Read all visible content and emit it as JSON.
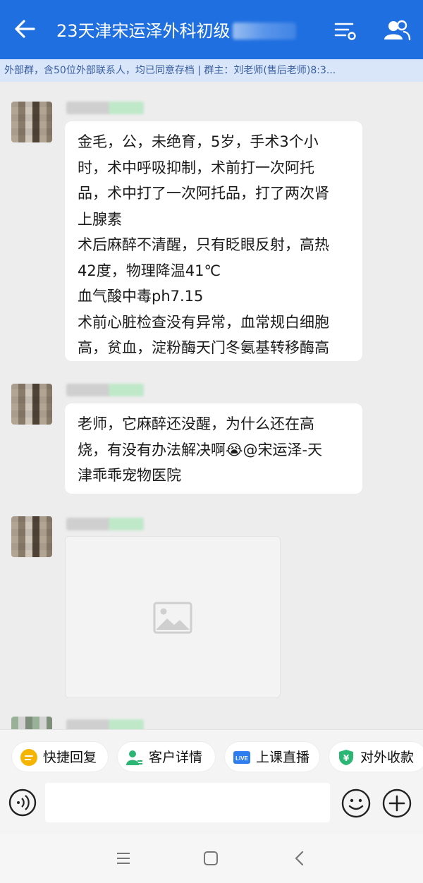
{
  "header": {
    "title": "23天津宋运泽外科初级",
    "subtitle": "外部群，含50位外部联系人，均已同意存档 | 群主：刘老师(售后老师)8:3..."
  },
  "messages": [
    {
      "type": "text",
      "lines": [
        "金毛，公，未绝育，5岁，手术3个小",
        "时，术中呼吸抑制，术前打一次阿托",
        "品，术中打了一次阿托品，打了两次肾",
        "上腺素",
        "术后麻醉不清醒，只有眨眼反射，高热",
        "42度，物理降温41℃",
        "血气酸中毒ph7.15",
        "术前心脏检查没有异常，血常规白细胞",
        "高，贫血，淀粉酶天门冬氨基转移酶高"
      ]
    },
    {
      "type": "text",
      "lines": [
        "老师，它麻醉还没醒，为什么还在高",
        "烧，有没有办法解决啊😭@宋运泽-天",
        "津乖乖宠物医院"
      ]
    },
    {
      "type": "image"
    }
  ],
  "quickbar": {
    "quick_reply": "快捷回复",
    "customer_details": "客户详情",
    "live_class": "上课直播",
    "live_badge": "LIVE",
    "payment": "对外收款",
    "payment_symbol": "¥"
  },
  "input": {
    "value": ""
  },
  "colors": {
    "header_bg": "#1f6fe0",
    "subbar_bg": "#d9e6fa",
    "chat_bg": "#ededed",
    "quick_reply_icon": "#f5b400",
    "customer_icon": "#2bb673",
    "live_icon": "#2f7ef0",
    "payment_icon": "#2bb673"
  },
  "icons": {
    "back": "back-arrow-icon",
    "menu": "list-settings-icon",
    "members": "group-members-icon",
    "image": "image-placeholder-icon",
    "voice": "voice-icon",
    "emoji": "emoji-icon",
    "plus": "plus-icon",
    "nav_menu": "nav-menu-icon",
    "nav_home": "nav-home-icon",
    "nav_back": "nav-back-icon"
  }
}
